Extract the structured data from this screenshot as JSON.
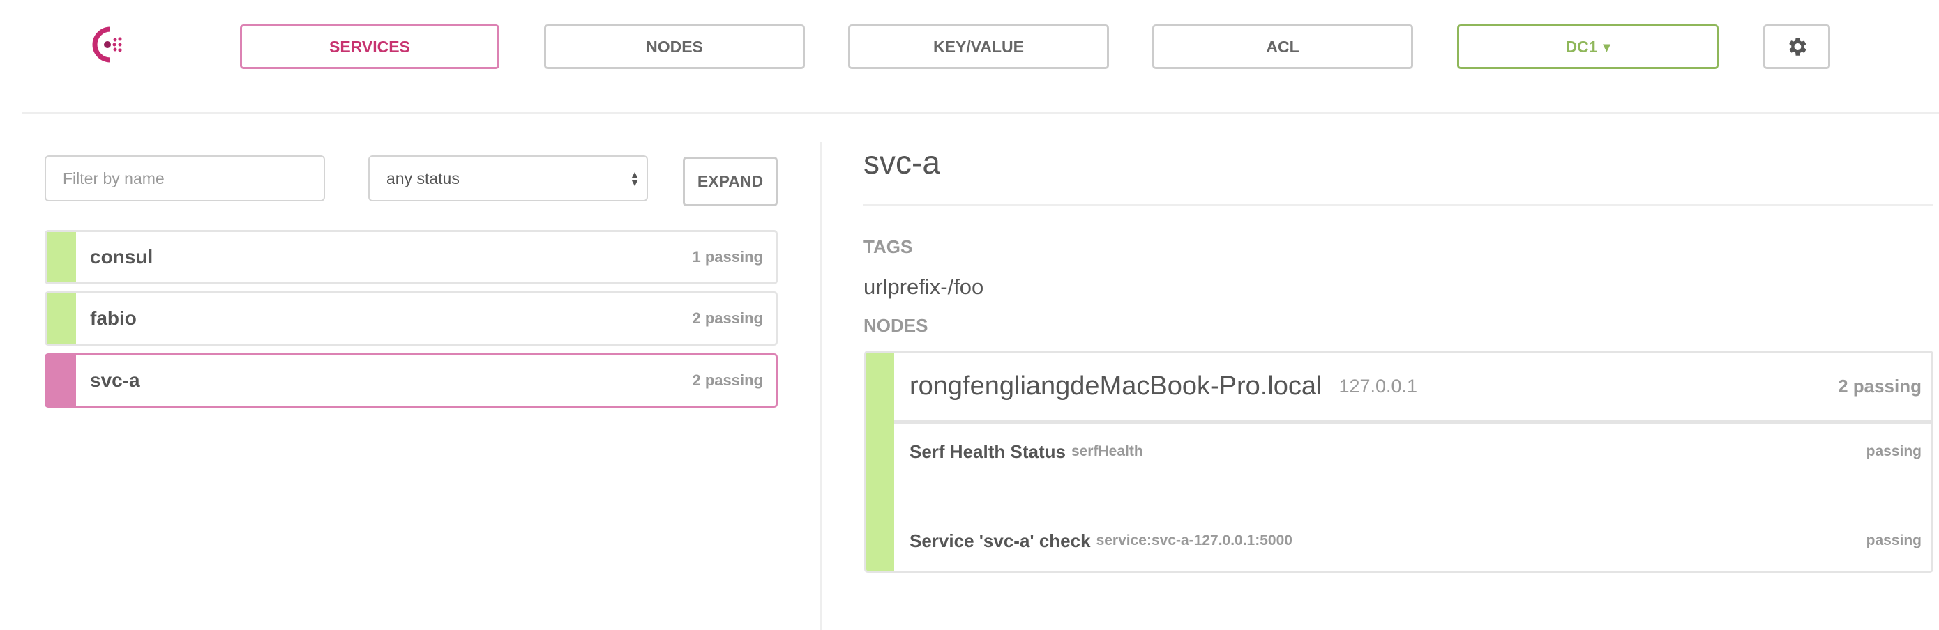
{
  "nav": {
    "services": "SERVICES",
    "nodes": "NODES",
    "keyvalue": "KEY/VALUE",
    "acl": "ACL",
    "dc": "DC1",
    "dc_caret": "▾",
    "settings_icon": "gear-icon"
  },
  "colors": {
    "accent": "#dc82b3",
    "accent_text": "#c7336f",
    "dc": "#8fb75a",
    "passing": "#c8ec96"
  },
  "filters": {
    "name_placeholder": "Filter by name",
    "status": "any status",
    "expand": "EXPAND"
  },
  "services": [
    {
      "name": "consul",
      "status": "1 passing"
    },
    {
      "name": "fabio",
      "status": "2 passing"
    },
    {
      "name": "svc-a",
      "status": "2 passing",
      "selected": true
    }
  ],
  "detail": {
    "title": "svc-a",
    "tags_label": "TAGS",
    "tags": [
      "urlprefix-/foo"
    ],
    "nodes_label": "NODES",
    "node": {
      "name": "rongfengliangdeMacBook-Pro.local",
      "address": "127.0.0.1",
      "status": "2 passing",
      "checks": [
        {
          "name": "Serf Health Status",
          "id": "serfHealth",
          "status": "passing"
        },
        {
          "name": "Service 'svc-a' check",
          "id": "service:svc-a-127.0.0.1:5000",
          "status": "passing"
        }
      ]
    }
  }
}
